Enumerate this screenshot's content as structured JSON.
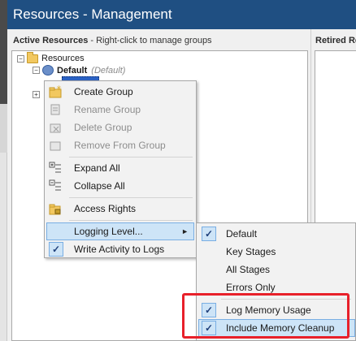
{
  "window": {
    "title": "Resources - Management"
  },
  "active_panel": {
    "heading": "Active Resources",
    "hint": " - Right-click to manage groups"
  },
  "retired_panel": {
    "heading": "Retired Re"
  },
  "tree": {
    "root": {
      "label": "Resources",
      "expander": "−"
    },
    "default": {
      "label": "Default",
      "note": "(Default)",
      "expander": "−"
    },
    "collapsed": {
      "expander": "+"
    }
  },
  "context_menu": {
    "items": [
      {
        "label": "Create Group",
        "icon": "new-folder-icon",
        "disabled": false
      },
      {
        "label": "Rename Group",
        "icon": "rename-icon",
        "disabled": true
      },
      {
        "label": "Delete Group",
        "icon": "delete-icon",
        "disabled": true
      },
      {
        "label": "Remove From Group",
        "icon": "remove-icon",
        "disabled": true
      },
      {
        "label": "Expand All",
        "icon": "expand-all-icon",
        "disabled": false
      },
      {
        "label": "Collapse All",
        "icon": "collapse-all-icon",
        "disabled": false
      },
      {
        "label": "Access Rights",
        "icon": "lock-folder-icon",
        "disabled": false
      },
      {
        "label": "Logging Level...",
        "icon": "",
        "submenu_arrow": "►"
      },
      {
        "label": "Write Activity to Logs",
        "check": "✓",
        "checked": true
      }
    ]
  },
  "logging_submenu": {
    "items": [
      {
        "label": "Default",
        "check": "✓",
        "checked": true
      },
      {
        "label": "Key Stages"
      },
      {
        "label": "All Stages"
      },
      {
        "label": "Errors Only"
      },
      {
        "label": "Log Memory Usage",
        "check": "✓",
        "checked": true
      },
      {
        "label": "Include Memory Cleanup",
        "check": "✓",
        "checked": true
      }
    ]
  },
  "colors": {
    "titlebar": "#1f4f82",
    "highlight": "#cde4f7",
    "annotation_box": "#e8202a"
  }
}
